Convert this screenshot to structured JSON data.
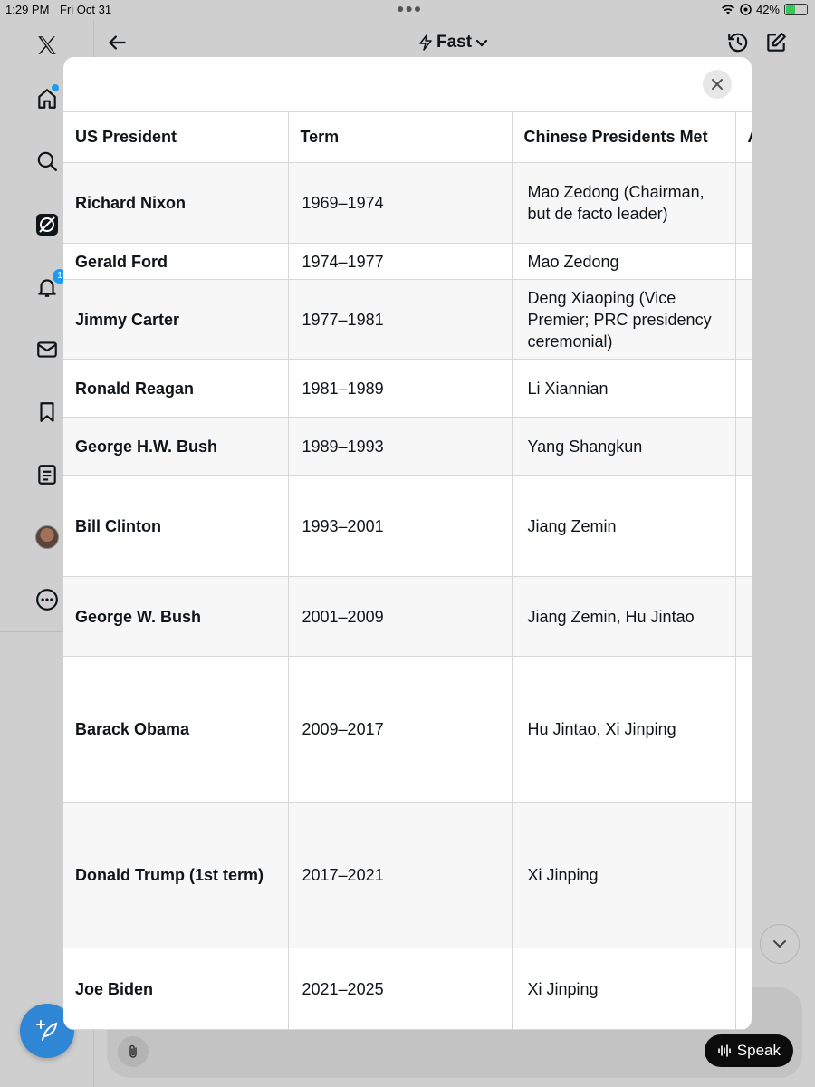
{
  "status_bar": {
    "time": "1:29 PM",
    "date": "Fri Oct 31",
    "battery": "42%",
    "battery_level": 0.42
  },
  "sidebar": {
    "notifications_badge": "1"
  },
  "header": {
    "mode_label": "Fast"
  },
  "composer": {
    "speak_label": "Speak"
  },
  "table": {
    "headers": [
      "US President",
      "Term",
      "Chinese Presidents Met",
      "A"
    ],
    "rows": [
      {
        "president": "Richard Nixon",
        "term": "1969–1974",
        "met": "Mao Zedong (Chairman, but de facto leader)"
      },
      {
        "president": "Gerald Ford",
        "term": "1974–1977",
        "met": "Mao Zedong"
      },
      {
        "president": "Jimmy Carter",
        "term": "1977–1981",
        "met": "Deng Xiaoping (Vice Premier; PRC presidency ceremonial)"
      },
      {
        "president": "Ronald Reagan",
        "term": "1981–1989",
        "met": "Li Xiannian"
      },
      {
        "president": "George H.W. Bush",
        "term": "1989–1993",
        "met": "Yang Shangkun"
      },
      {
        "president": "Bill Clinton",
        "term": "1993–2001",
        "met": "Jiang Zemin"
      },
      {
        "president": "George W. Bush",
        "term": "2001–2009",
        "met": "Jiang Zemin, Hu Jintao"
      },
      {
        "president": "Barack Obama",
        "term": "2009–2017",
        "met": "Hu Jintao, Xi Jinping"
      },
      {
        "president": "Donald Trump (1st term)",
        "term": "2017–2021",
        "met": "Xi Jinping"
      },
      {
        "president": "Joe Biden",
        "term": "2021–2025",
        "met": "Xi Jinping"
      }
    ]
  },
  "icons": {
    "sidebar": [
      "x-logo-icon",
      "home-icon",
      "search-icon",
      "grok-icon",
      "bell-icon",
      "mail-icon",
      "bookmark-icon",
      "list-icon",
      "avatar",
      "more-icon"
    ],
    "header": [
      "back-arrow-icon",
      "lightning-icon",
      "chevron-down-icon",
      "history-icon",
      "compose-icon"
    ],
    "composer": [
      "paperclip-icon",
      "waveform-icon"
    ],
    "modal": [
      "close-icon"
    ]
  },
  "colors": {
    "accent": "#1d9bf0",
    "fab": "#2f86d4",
    "battery_fill": "#34c759"
  }
}
